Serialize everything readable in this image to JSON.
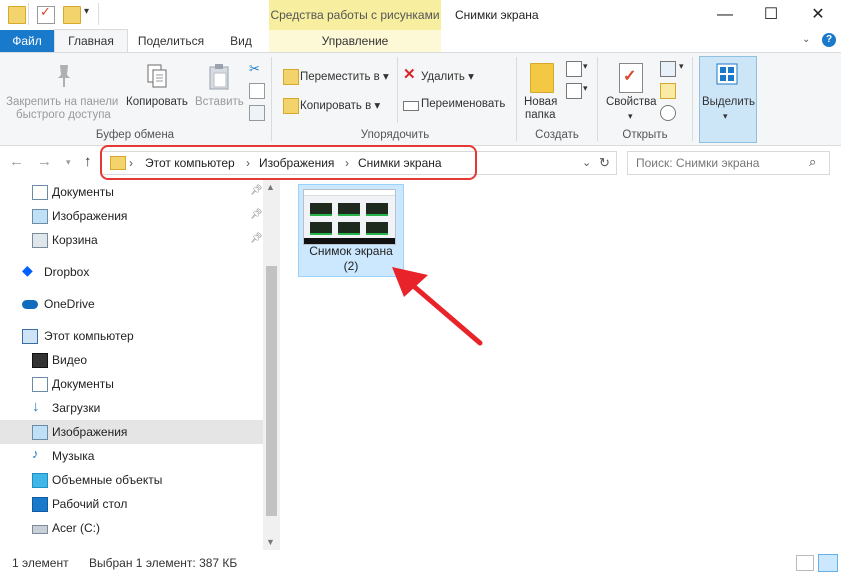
{
  "window": {
    "title": "Снимки экрана",
    "context_tab_group": "Средства работы с рисунками",
    "minimize": "—",
    "maximize": "☐",
    "close": "✕"
  },
  "tabs": {
    "file": "Файл",
    "home": "Главная",
    "share": "Поделиться",
    "view": "Вид",
    "manage": "Управление"
  },
  "ribbon": {
    "clipboard": {
      "pin": "Закрепить на панели быстрого доступа",
      "pin_line1": "Закрепить на панели",
      "pin_line2": "быстрого доступа",
      "copy": "Копировать",
      "paste": "Вставить",
      "group": "Буфер обмена"
    },
    "organize": {
      "move_to": "Переместить в",
      "copy_to": "Копировать в",
      "delete": "Удалить",
      "rename": "Переименовать",
      "group": "Упорядочить"
    },
    "new": {
      "new_folder_line1": "Новая",
      "new_folder_line2": "папка",
      "group": "Создать"
    },
    "open": {
      "properties": "Свойства",
      "group": "Открыть"
    },
    "select": {
      "select": "Выделить"
    }
  },
  "address": {
    "crumbs": [
      "Этот компьютер",
      "Изображения",
      "Снимки экрана"
    ],
    "search_placeholder": "Поиск: Снимки экрана"
  },
  "nav": {
    "items": [
      {
        "label": "Документы",
        "icon": "documents-icon",
        "pinned": true
      },
      {
        "label": "Изображения",
        "icon": "pictures-icon",
        "pinned": true
      },
      {
        "label": "Корзина",
        "icon": "recycle-bin-icon",
        "pinned": true
      },
      {
        "label": "Dropbox",
        "icon": "dropbox-icon"
      },
      {
        "label": "OneDrive",
        "icon": "onedrive-icon"
      },
      {
        "label": "Этот компьютер",
        "icon": "this-pc-icon"
      },
      {
        "label": "Видео",
        "icon": "videos-icon"
      },
      {
        "label": "Документы",
        "icon": "documents-icon"
      },
      {
        "label": "Загрузки",
        "icon": "downloads-icon"
      },
      {
        "label": "Изображения",
        "icon": "pictures-icon",
        "selected": true
      },
      {
        "label": "Музыка",
        "icon": "music-icon"
      },
      {
        "label": "Объемные объекты",
        "icon": "3d-objects-icon"
      },
      {
        "label": "Рабочий стол",
        "icon": "desktop-icon"
      },
      {
        "label": "Acer (C:)",
        "icon": "drive-icon"
      }
    ]
  },
  "content": {
    "file_name_line1": "Снимок экрана",
    "file_name_line2": "(2)"
  },
  "status": {
    "count": "1 элемент",
    "selection": "Выбран 1 элемент: 387 КБ"
  },
  "colors": {
    "accent": "#1979ca",
    "selection": "#cce8ff",
    "highlight_red": "#e53935",
    "context_tab": "#f7eea0"
  }
}
